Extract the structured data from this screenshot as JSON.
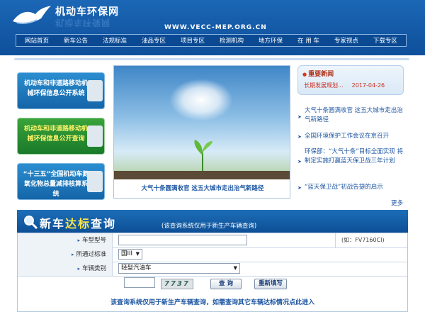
{
  "header": {
    "site_title": "机动车环保网",
    "site_title_reflection": "机动车环保网",
    "url_text": "WWW.VECC-MEP.ORG.CN"
  },
  "nav": {
    "items": [
      "网站首页",
      "新车公告",
      "法规标准",
      "油品专区",
      "项目专区",
      "检测机构",
      "地方环保",
      "在 用 车",
      "专家视点",
      "下载专区"
    ]
  },
  "left_links": {
    "box1": "机动车和非道路移动机械环保信息公开系统",
    "box2": "机动车和非道路移动机械环保信息公开查询",
    "box3": "“十三五”全国机动车氮氧化物总量减排核算系统"
  },
  "photo": {
    "caption": "大气十条圆满收官 这五大城市走出治气新路径"
  },
  "news": {
    "heading": "重要新闻",
    "headline": "长期发展规划...",
    "headline_date": "2017-04-26",
    "items": [
      "大气十条圆满收官 这五大城市走出治气新路径",
      "全国环境保护工作会议在京召开",
      "环保部：“大气十条”目标全面实现 将制定实施打赢蓝天保卫战三年计划",
      "“蓝天保卫战”初战告捷的启示"
    ],
    "more": "更多"
  },
  "query": {
    "title_part1": "新车",
    "title_part2": "达标",
    "title_part3": "查询",
    "note": "(该查询系统仅用于新生产车辆查询)",
    "row_model_label": "车型型号",
    "row_model_value": "",
    "row_model_hint": "(如：FV7160CI)",
    "row_standard_label": "所通过标准",
    "row_standard_value": "国III",
    "row_type_label": "车辆类别",
    "row_type_value": "轻型汽油车",
    "captcha_input": "",
    "captcha_text": "7737",
    "search_button": "查 询",
    "reset_button": "重新填写",
    "footer_note": "该查询系统仅用于新生产车辆查询，如需查询其它车辆达标情况点此进入"
  }
}
